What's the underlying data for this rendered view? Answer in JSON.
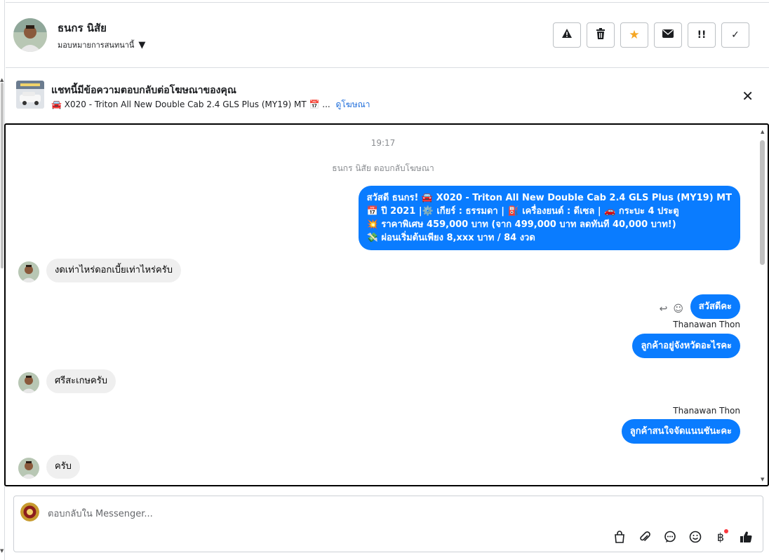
{
  "header": {
    "contact_name": "ธนกร นิสัย",
    "assign_label": "มอบหมายการสนทนานี้",
    "actions": [
      {
        "name": "spam-button",
        "icon": "warning-icon",
        "glyph": "⚠"
      },
      {
        "name": "delete-button",
        "icon": "trash-icon",
        "glyph": "🗑"
      },
      {
        "name": "star-button",
        "icon": "star-icon",
        "glyph": "★"
      },
      {
        "name": "unread-button",
        "icon": "envelope-icon",
        "glyph": "✉"
      },
      {
        "name": "follow-up-button",
        "icon": "exclamation-icon",
        "glyph": "!!"
      },
      {
        "name": "done-button",
        "icon": "check-icon",
        "glyph": "✓"
      }
    ]
  },
  "ad_banner": {
    "title": "แชทนี้มีข้อความตอบกลับต่อโฆษณาของคุณ",
    "ad_text": "🚘 X020 - Triton All New Double Cab 2.4 GLS Plus (MY19) MT 📅 ...",
    "view_ad_link": "ดูโฆษณา",
    "close_glyph": "✕"
  },
  "conversation": {
    "time": "19:17",
    "system_note": "ธนกร นิสัย ตอบกลับโฆษณา",
    "ad_reply_lines": [
      "สวัสดี ธนกร! 🚘 X020 - Triton All New Double Cab 2.4 GLS Plus (MY19) MT",
      "📅 ปี 2021 |⚙️ เกียร์ : ธรรมดา | ⛽ เครื่องยนต์ : ดีเซล | 🚗 กระบะ 4 ประตู",
      "💥 ราคาพิเศษ 459,000 บาท (จาก 499,000 บาท ลดทันที 40,000 บาท!)",
      "💸 ผ่อนเริ่มต้นเพียง 8,xxx บาท / 84 งวด"
    ],
    "msg_in_1": "งดเท่าไหร่ดอกเบี้ยเท่าไหร่ครับ",
    "msg_out_1": "สวัสดีคะ",
    "sender_1": "Thanawan Thon",
    "msg_out_2": "ลูกค้าอยู่จังหวัดอะไรคะ",
    "msg_in_2": "ศรีสะเกษครับ",
    "sender_2": "Thanawan Thon",
    "msg_out_3": "ลูกค้าสนใจจัดแนนชันะคะ",
    "msg_in_3": "ครับ",
    "message_tools": {
      "reply_icon": "reply-icon",
      "react_icon": "smiley-icon"
    }
  },
  "composer": {
    "placeholder": "ตอบกลับใน Messenger...",
    "tools": [
      {
        "name": "shopping-bag-icon",
        "glyph": "🛍"
      },
      {
        "name": "paperclip-icon",
        "glyph": "📎"
      },
      {
        "name": "saved-reply-icon",
        "glyph": "💬"
      },
      {
        "name": "emoji-icon",
        "glyph": "☺"
      },
      {
        "name": "baht-icon",
        "glyph": "฿"
      },
      {
        "name": "thumbs-up-icon",
        "glyph": "👍"
      }
    ]
  },
  "colors": {
    "outgoing_bubble": "#0a7cff",
    "incoming_bubble": "#efefef",
    "star": "#f5a623",
    "link": "#216fdb",
    "notification_dot": "#fa383e"
  }
}
